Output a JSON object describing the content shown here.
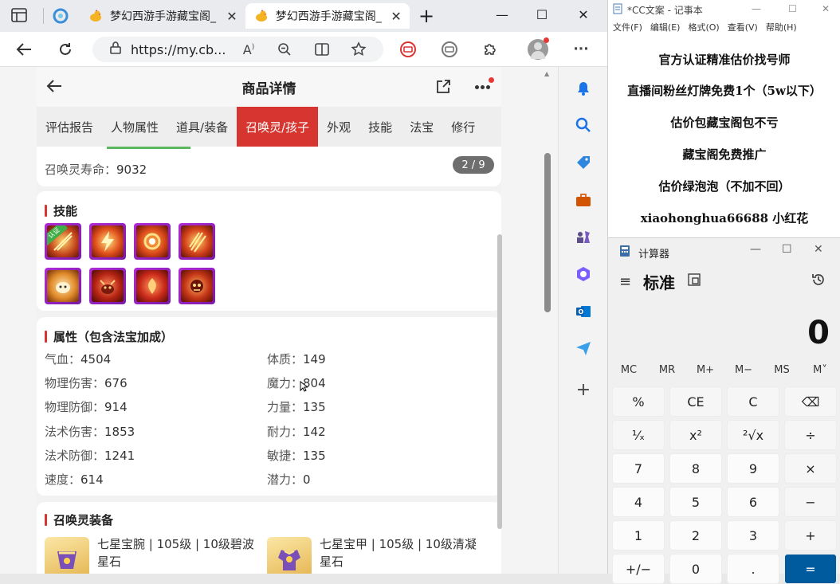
{
  "browser": {
    "tabs": [
      {
        "title": "梦幻西游手游藏宝阁_"
      },
      {
        "title": "梦幻西游手游藏宝阁_"
      }
    ],
    "new_tab": "+",
    "url": "https://my.cb..."
  },
  "app": {
    "header_title": "商品详情",
    "tabs": [
      "评估报告",
      "人物属性",
      "道具/装备",
      "召唤灵/孩子",
      "外观",
      "技能",
      "法宝",
      "修行"
    ],
    "active_tab": "召唤灵/孩子",
    "lifespan_label": "召唤灵寿命：",
    "lifespan_value": "9032",
    "pager": "2 / 9",
    "skills_title": "技能",
    "skill_badge": "认证",
    "attrs_title": "属性（包含法宝加成）",
    "attrs_left": [
      {
        "k": "气血：",
        "v": "4504"
      },
      {
        "k": "物理伤害：",
        "v": "676"
      },
      {
        "k": "物理防御：",
        "v": "914"
      },
      {
        "k": "法术伤害：",
        "v": "1853"
      },
      {
        "k": "法术防御：",
        "v": "1241"
      },
      {
        "k": "速度：",
        "v": "614"
      }
    ],
    "attrs_right": [
      {
        "k": "体质：",
        "v": "149"
      },
      {
        "k": "魔力：",
        "v": "804"
      },
      {
        "k": "力量：",
        "v": "135"
      },
      {
        "k": "耐力：",
        "v": "142"
      },
      {
        "k": "敏捷：",
        "v": "135"
      },
      {
        "k": "潜力：",
        "v": "0"
      }
    ],
    "equip_title": "召唤灵装备",
    "equips": [
      {
        "line1": "七星宝腕 | 105级 | 10级碧波",
        "line2": "星石"
      },
      {
        "line1": "七星宝甲 | 105级 | 10级清凝",
        "line2": "星石"
      }
    ]
  },
  "notepad": {
    "title": "*CC文案 - 记事本",
    "menu": [
      "文件(F)",
      "编辑(E)",
      "格式(O)",
      "查看(V)",
      "帮助(H)"
    ],
    "lines": [
      "官方认证精准估价找号师",
      "直播间粉丝灯牌免费1个（5w以下）",
      "估价包藏宝阁包不亏",
      "藏宝阁免费推广",
      "估价绿泡泡（不加不回）",
      "xiaohonghua66688  小红花"
    ]
  },
  "calculator": {
    "title": "计算器",
    "mode": "标准",
    "display": "0",
    "memory": [
      "MC",
      "MR",
      "M+",
      "M−",
      "MS",
      "M˅"
    ],
    "keys": [
      [
        "%",
        "CE",
        "C",
        "⌫"
      ],
      [
        "¹⁄ₓ",
        "x²",
        "²√x",
        "÷"
      ],
      [
        "7",
        "8",
        "9",
        "×"
      ],
      [
        "4",
        "5",
        "6",
        "−"
      ],
      [
        "1",
        "2",
        "3",
        "+"
      ],
      [
        "+/−",
        "0",
        ".",
        "="
      ]
    ]
  },
  "colors": {
    "accent": "#d6362f",
    "skill_frame": "#b02bd6"
  }
}
